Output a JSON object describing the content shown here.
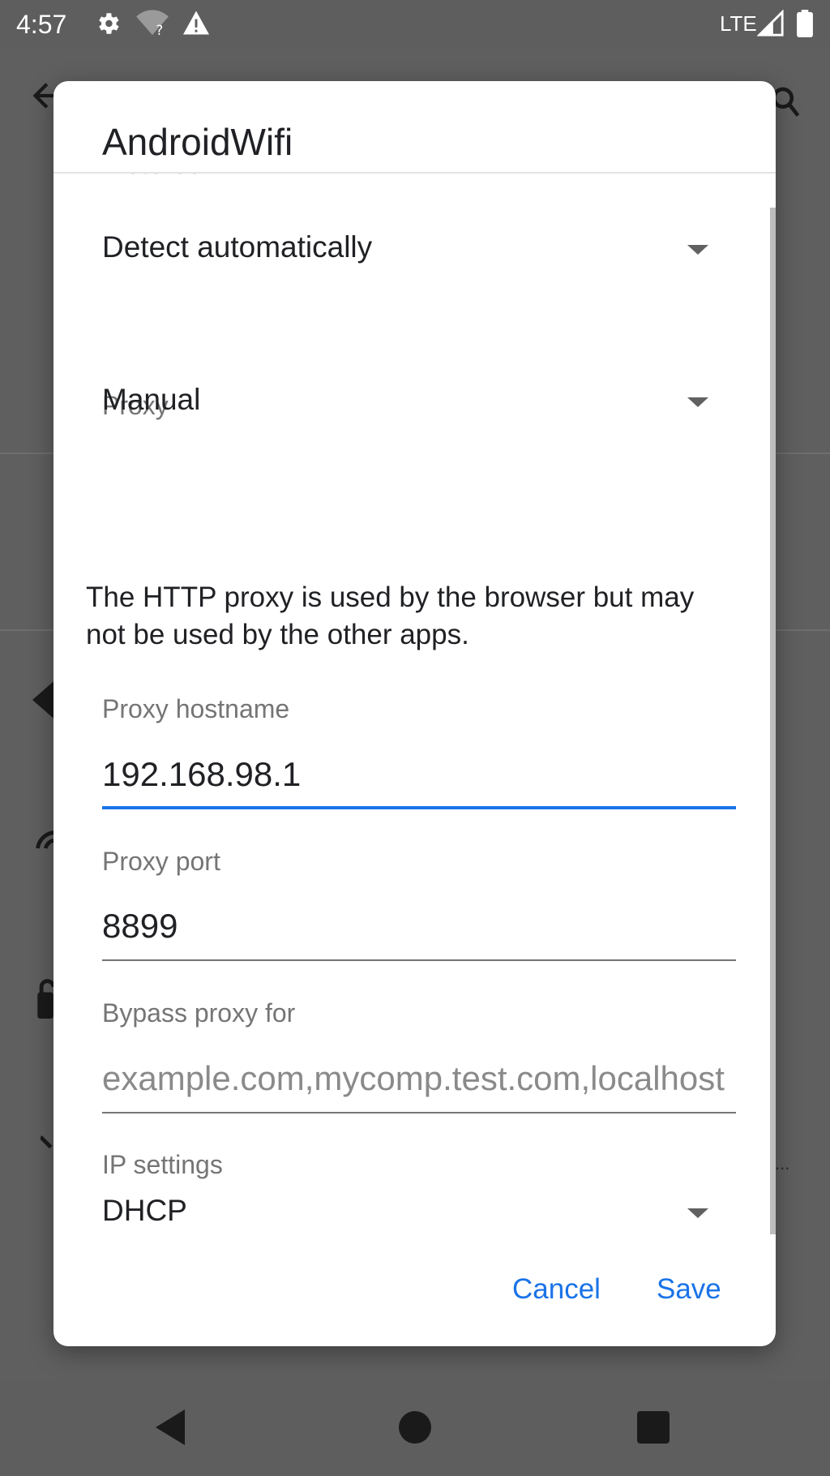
{
  "status_bar": {
    "time": "4:57",
    "network": "LTE",
    "icons": [
      "settings-gear-icon",
      "wifi-unknown-icon",
      "warning-icon",
      "cell-signal-icon",
      "battery-icon"
    ]
  },
  "dialog": {
    "title": "AndroidWifi",
    "metered": {
      "label": "Metered",
      "value": "Detect automatically"
    },
    "proxy": {
      "label": "Proxy",
      "value": "Manual"
    },
    "info_text": "The HTTP proxy is used by the browser but may not be used by the other apps.",
    "proxy_hostname": {
      "label": "Proxy hostname",
      "value": "192.168.98.1"
    },
    "proxy_port": {
      "label": "Proxy port",
      "value": "8899"
    },
    "bypass": {
      "label": "Bypass proxy for",
      "placeholder": "example.com,mycomp.test.com,localhost"
    },
    "ip_settings": {
      "label": "IP settings",
      "value": "DHCP"
    },
    "buttons": {
      "cancel": "Cancel",
      "save": "Save"
    }
  },
  "background": {
    "ellipsis": "..."
  },
  "colors": {
    "accent": "#1a73e8",
    "scrim": "#5f5f5f",
    "dialog_bg": "#ffffff"
  }
}
